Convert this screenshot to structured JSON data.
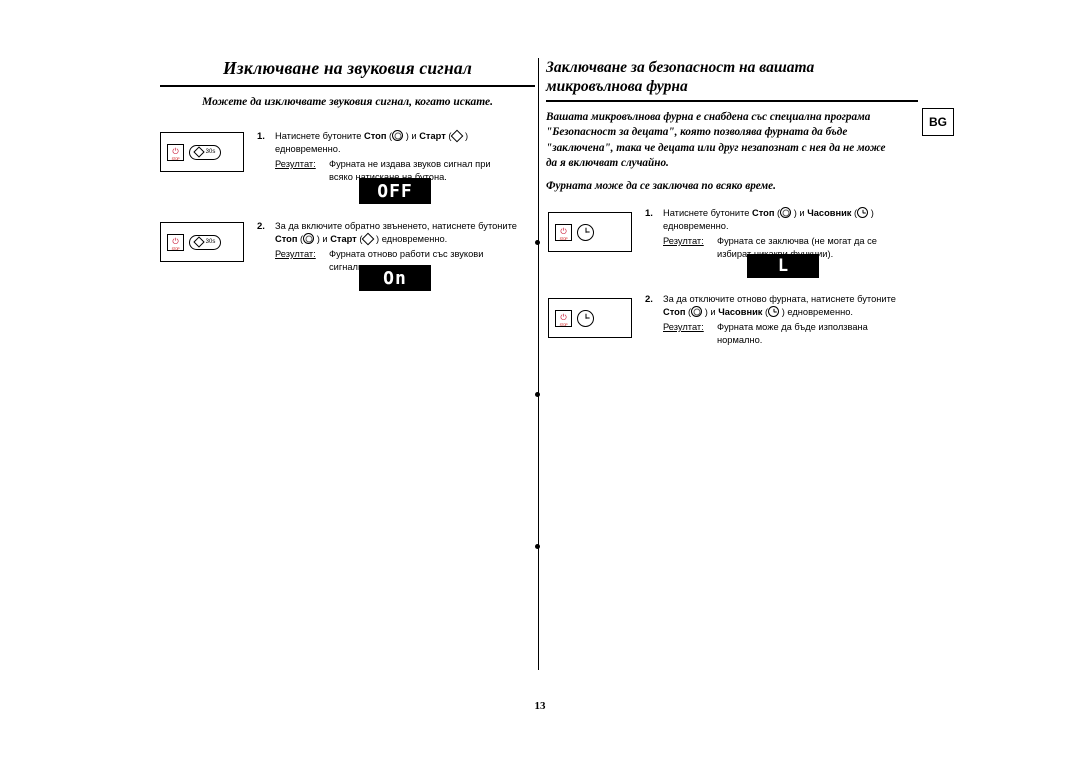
{
  "page": {
    "number": "13",
    "language_badge": "BG"
  },
  "left_section": {
    "title": "Изключване на звуковия сигнал",
    "subtitle": "Можете да изключвате звуковия сигнал, когато искате.",
    "steps": [
      {
        "num": "1.",
        "line1_pre": "Натиснете бутоните ",
        "bold1": "Стоп",
        "mid": " ) и ",
        "bold2": "Старт",
        "line1_post": " )",
        "line2": "едновременно.",
        "result_label": "Резултат:",
        "result_line1": "Фурната не издава звуков сигнал при",
        "result_line2": "всяко натискане на бутона.",
        "panel_sublabel": "30s",
        "display": "OFF"
      },
      {
        "num": "2.",
        "line1": "За да включите обратно звъненето, натиснете бутоните",
        "bold1": "Стоп",
        "mid": " ) и ",
        "bold2": "Старт",
        "line2_post": " ) едновременно.",
        "result_label": "Резултат:",
        "result_line1": "Фурната отново работи със звукови",
        "result_line2": "сигнали.",
        "panel_sublabel": "30s",
        "display": "On"
      }
    ]
  },
  "right_section": {
    "title_line1": "Заключване за безопасност на вашата",
    "title_line2": "микровълнова фурна",
    "subtitle_line1": "Вашата микровълнова фурна е снабдена със специална програма",
    "subtitle_line2": "\"Безопасност за децата\", която позволява фурната да бъде",
    "subtitle_line3": "\"заключена\", така че децата или друг незапознат с нея да не може",
    "subtitle_line4": "да я включват случайно.",
    "subtitle_line5": "Фурната може да се заключва по всяко време.",
    "steps": [
      {
        "num": "1.",
        "line1_pre": "Натиснете бутоните ",
        "bold1": "Стоп",
        "mid": " ) и ",
        "bold2": "Часовник",
        "line1_post": " )",
        "line2": "едновременно.",
        "result_label": "Резултат:",
        "result_line1": "Фурната се заключва (не могат да се",
        "result_line2": "избират никакви функции).",
        "display": "L"
      },
      {
        "num": "2.",
        "line1": "За да отключите отново фурната, натиснете бутоните",
        "bold1": "Стоп",
        "mid": " ) и ",
        "bold2": "Часовник",
        "line2_post": " ) едновременно.",
        "result_label": "Резултат:",
        "result_line1": "Фурната може да бъде използвана",
        "result_line2": "нормално."
      }
    ]
  },
  "icons": {
    "stop": "stop-button-icon",
    "start": "start-button-icon",
    "clock": "clock-button-icon",
    "power": "microwave-power-icon"
  }
}
